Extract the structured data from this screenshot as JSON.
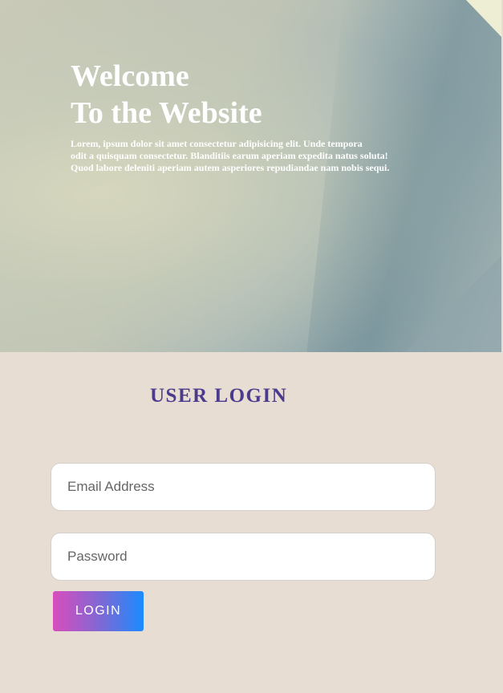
{
  "hero": {
    "title_line1": "Welcome",
    "title_line2": "To the Website",
    "description_line1": "Lorem, ipsum dolor sit amet consectetur adipisicing elit. Unde tempora",
    "description_line2": "odit a quisquam consectetur. Blanditiis earum aperiam expedita natus soluta!",
    "description_line3": "Quod labore deleniti aperiam autem asperiores repudiandae nam nobis sequi."
  },
  "login": {
    "title": "USER LOGIN",
    "email_placeholder": "Email Address",
    "password_placeholder": "Password",
    "button_label": "LOGIN"
  },
  "colors": {
    "background": "#e8ddd3",
    "title": "#4b3b8c",
    "button_gradient_start": "#d94dbc",
    "button_gradient_end": "#1a8bff"
  }
}
